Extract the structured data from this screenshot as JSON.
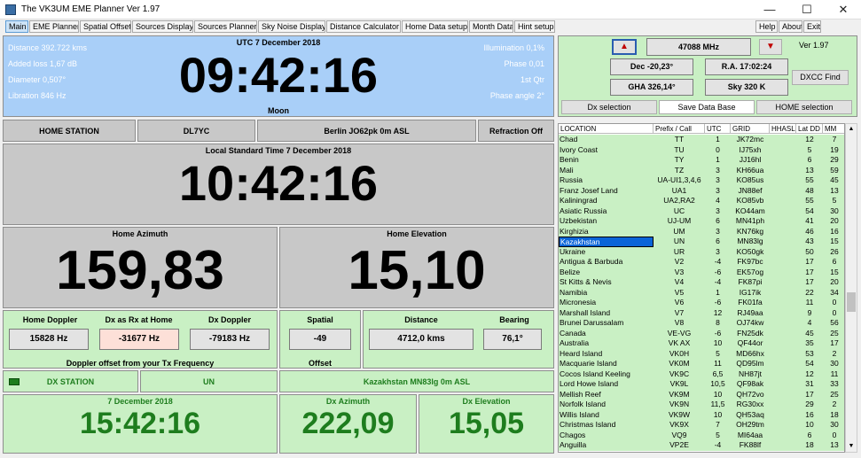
{
  "window": {
    "title": "The VK3UM EME Planner Ver 1.97",
    "min": "—",
    "max": "☐",
    "close": "✕"
  },
  "tabs": [
    {
      "label": "Main",
      "active": true
    },
    {
      "label": "EME Planner"
    },
    {
      "label": "Spatial Offset"
    },
    {
      "label": "Sources Display"
    },
    {
      "label": "Sources Planner"
    },
    {
      "label": "Sky Noise Display"
    },
    {
      "label": "Distance Calculator"
    },
    {
      "label": "Home Data setup"
    },
    {
      "label": "Month Data"
    },
    {
      "label": "Hint setup"
    }
  ],
  "right_tabs": [
    "Help",
    "About",
    "Exit"
  ],
  "moon": {
    "distance": "Distance 392.722 kms",
    "added_loss": "Added loss 1,67 dB",
    "diameter": "Diameter  0,507°",
    "libration": "Libration  846 Hz",
    "utc_label": "UTC  7 December  2018",
    "utc_time": "09:42:16",
    "body": "Moon",
    "illumination": "Illumination 0,1%",
    "phase": "Phase   0,01",
    "quarter": "1st Qtr",
    "phase_angle": "Phase angle 2°"
  },
  "home_bar": {
    "label": "HOME STATION",
    "call": "DL7YC",
    "location": "Berlin  JO62pk  0m ASL",
    "refraction": "Refraction Off"
  },
  "local": {
    "label": "Local Standard Time 7 December  2018",
    "time": "10:42:16"
  },
  "home_az": {
    "label": "Home Azimuth",
    "value": "159,83"
  },
  "home_el": {
    "label": "Home Elevation",
    "value": "15,10"
  },
  "doppler": {
    "home_label": "Home Doppler",
    "home": "15828 Hz",
    "dxrx_label": "Dx as  Rx at Home",
    "dxrx": "-31677 Hz",
    "dx_label": "Dx Doppler",
    "dx": "-79183 Hz",
    "note": "Doppler offset from your Tx Frequency"
  },
  "spatial": {
    "label": "Spatial",
    "value": "-49",
    "offset": "Offset"
  },
  "distance": {
    "label": "Distance",
    "value": "4712,0 kms"
  },
  "bearing": {
    "label": "Bearing",
    "value": "76,1°"
  },
  "dx_bar": {
    "label": "DX STATION",
    "call": "UN",
    "location": "Kazakhstan   MN83lg  0m ASL"
  },
  "dx_time": {
    "date": "7 December  2018",
    "time": "15:42:16"
  },
  "dx_az": {
    "label": "Dx Azimuth",
    "value": "222,09"
  },
  "dx_el": {
    "label": "Dx Elevation",
    "value": "15,05"
  },
  "control": {
    "up": "▲",
    "freq": "47088 MHz",
    "down": "▼",
    "version": "Ver 1.97",
    "dec": "Dec -20,23°",
    "ra": "R.A. 17:02:24",
    "dxcc": "DXCC Find",
    "gha": "GHA 326,14°",
    "sky": "Sky 320 K",
    "dx_sel": "Dx selection",
    "save": "Save Data Base",
    "home_sel": "HOME selection"
  },
  "table": {
    "headers": [
      "LOCATION",
      "Prefix / Call",
      "UTC",
      "GRID",
      "HHASL",
      "Lat DD",
      "MM"
    ],
    "rows": [
      [
        "Chad",
        "TT",
        "1",
        "JK72mc",
        "",
        "12",
        "7"
      ],
      [
        "Ivory Coast",
        "TU",
        "0",
        "IJ75xh",
        "",
        "5",
        "19"
      ],
      [
        "Benin",
        "TY",
        "1",
        "JJ16hl",
        "",
        "6",
        "29"
      ],
      [
        "Mali",
        "TZ",
        "3",
        "KH66ua",
        "",
        "13",
        "59"
      ],
      [
        "Russia",
        "UA-UI1,3,4,6",
        "3",
        "KO85us",
        "",
        "55",
        "45"
      ],
      [
        "Franz Josef Land",
        "UA1",
        "3",
        "JN88ef",
        "",
        "48",
        "13"
      ],
      [
        "Kaliningrad",
        "UA2,RA2",
        "4",
        "KO85vb",
        "",
        "55",
        "5"
      ],
      [
        "Asiatic Russia",
        "UC",
        "3",
        "KO44am",
        "",
        "54",
        "30"
      ],
      [
        "Uzbekistan",
        "UJ-UM",
        "6",
        "MN41ph",
        "",
        "41",
        "20"
      ],
      [
        "Kirghizia",
        "UM",
        "3",
        "KN76kg",
        "",
        "46",
        "16"
      ],
      [
        "Kazakhstan",
        "UN",
        "6",
        "MN83lg",
        "",
        "43",
        "15"
      ],
      [
        "Ukraine",
        "UR",
        "3",
        "KO50gk",
        "",
        "50",
        "26"
      ],
      [
        "Antigua & Barbuda",
        "V2",
        "-4",
        "FK97bc",
        "",
        "17",
        "6"
      ],
      [
        "Belize",
        "V3",
        "-6",
        "EK57og",
        "",
        "17",
        "15"
      ],
      [
        "St Kitts & Nevis",
        "V4",
        "-4",
        "FK87pi",
        "",
        "17",
        "20"
      ],
      [
        "Namibia",
        "V5",
        "1",
        "IG17ik",
        "",
        "22",
        "34"
      ],
      [
        "Micronesia",
        "V6",
        "-6",
        "FK01fa",
        "",
        "11",
        "0"
      ],
      [
        "Marshall Island",
        "V7",
        "12",
        "RJ49aa",
        "",
        "9",
        "0"
      ],
      [
        "Brunei Darussalam",
        "V8",
        "8",
        "OJ74kw",
        "",
        "4",
        "56"
      ],
      [
        "Canada",
        "VE-VG",
        "-6",
        "FN25dk",
        "",
        "45",
        "25"
      ],
      [
        "Australia",
        "VK AX",
        "10",
        "QF44or",
        "",
        "35",
        "17"
      ],
      [
        "Heard Island",
        "VK0H",
        "5",
        "MD66hx",
        "",
        "53",
        "2"
      ],
      [
        "Macquarie Island",
        "VK0M",
        "11",
        "QD95lm",
        "",
        "54",
        "30"
      ],
      [
        "Cocos Island Keeling",
        "VK9C",
        "6,5",
        "NH87jt",
        "",
        "12",
        "11"
      ],
      [
        "Lord Howe Island",
        "VK9L",
        "10,5",
        "QF98ak",
        "",
        "31",
        "33"
      ],
      [
        "Mellish Reef",
        "VK9M",
        "10",
        "QH72vo",
        "",
        "17",
        "25"
      ],
      [
        "Norfolk Island",
        "VK9N",
        "11,5",
        "RG30xx",
        "",
        "29",
        "2"
      ],
      [
        "Willis Island",
        "VK9W",
        "10",
        "QH53aq",
        "",
        "16",
        "18"
      ],
      [
        "Christmas Island",
        "VK9X",
        "7",
        "OH29tm",
        "",
        "10",
        "30"
      ],
      [
        "Chagos",
        "VQ9",
        "5",
        "MI64aa",
        "",
        "6",
        "0"
      ],
      [
        "Anguilla",
        "VP2E",
        "-4",
        "FK88lf",
        "",
        "18",
        "13"
      ]
    ],
    "selected": 10
  }
}
